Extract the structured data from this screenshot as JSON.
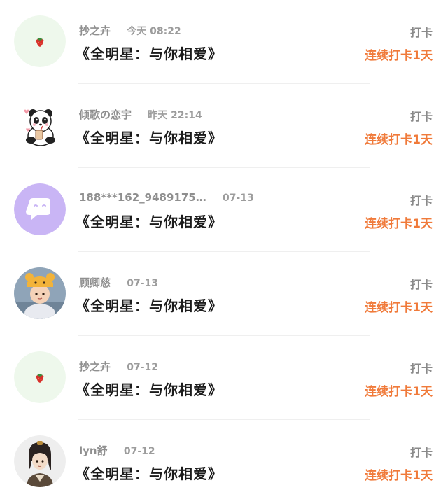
{
  "checkins": [
    {
      "username": "抄之卉",
      "time": "今天 08:22",
      "title": "《全明星：与你相爱》",
      "action": "打卡",
      "streak": "连续打卡1天",
      "avatar": "strawberry-avatar"
    },
    {
      "username": "倾歌の恋宇",
      "time": "昨天 22:14",
      "title": "《全明星：与你相爱》",
      "action": "打卡",
      "streak": "连续打卡1天",
      "avatar": "panda-avatar"
    },
    {
      "username": "188***162_9489175…",
      "time": "07-13",
      "title": "《全明星：与你相爱》",
      "action": "打卡",
      "streak": "连续打卡1天",
      "avatar": "default-chat-avatar"
    },
    {
      "username": "顾卿慈",
      "time": "07-13",
      "title": "《全明星：与你相爱》",
      "action": "打卡",
      "streak": "连续打卡1天",
      "avatar": "child-photo-avatar"
    },
    {
      "username": "抄之卉",
      "time": "07-12",
      "title": "《全明星：与你相爱》",
      "action": "打卡",
      "streak": "连续打卡1天",
      "avatar": "strawberry-avatar"
    },
    {
      "username": "lyn舒",
      "time": "07-12",
      "title": "《全明星：与你相爱》",
      "action": "打卡",
      "streak": "连续打卡1天",
      "avatar": "anime-character-avatar"
    }
  ],
  "colors": {
    "streak": "#f07a3a",
    "title": "#1c1c1c",
    "meta": "#8f8f8f",
    "default_avatar_bg": "#c9b5f5"
  }
}
